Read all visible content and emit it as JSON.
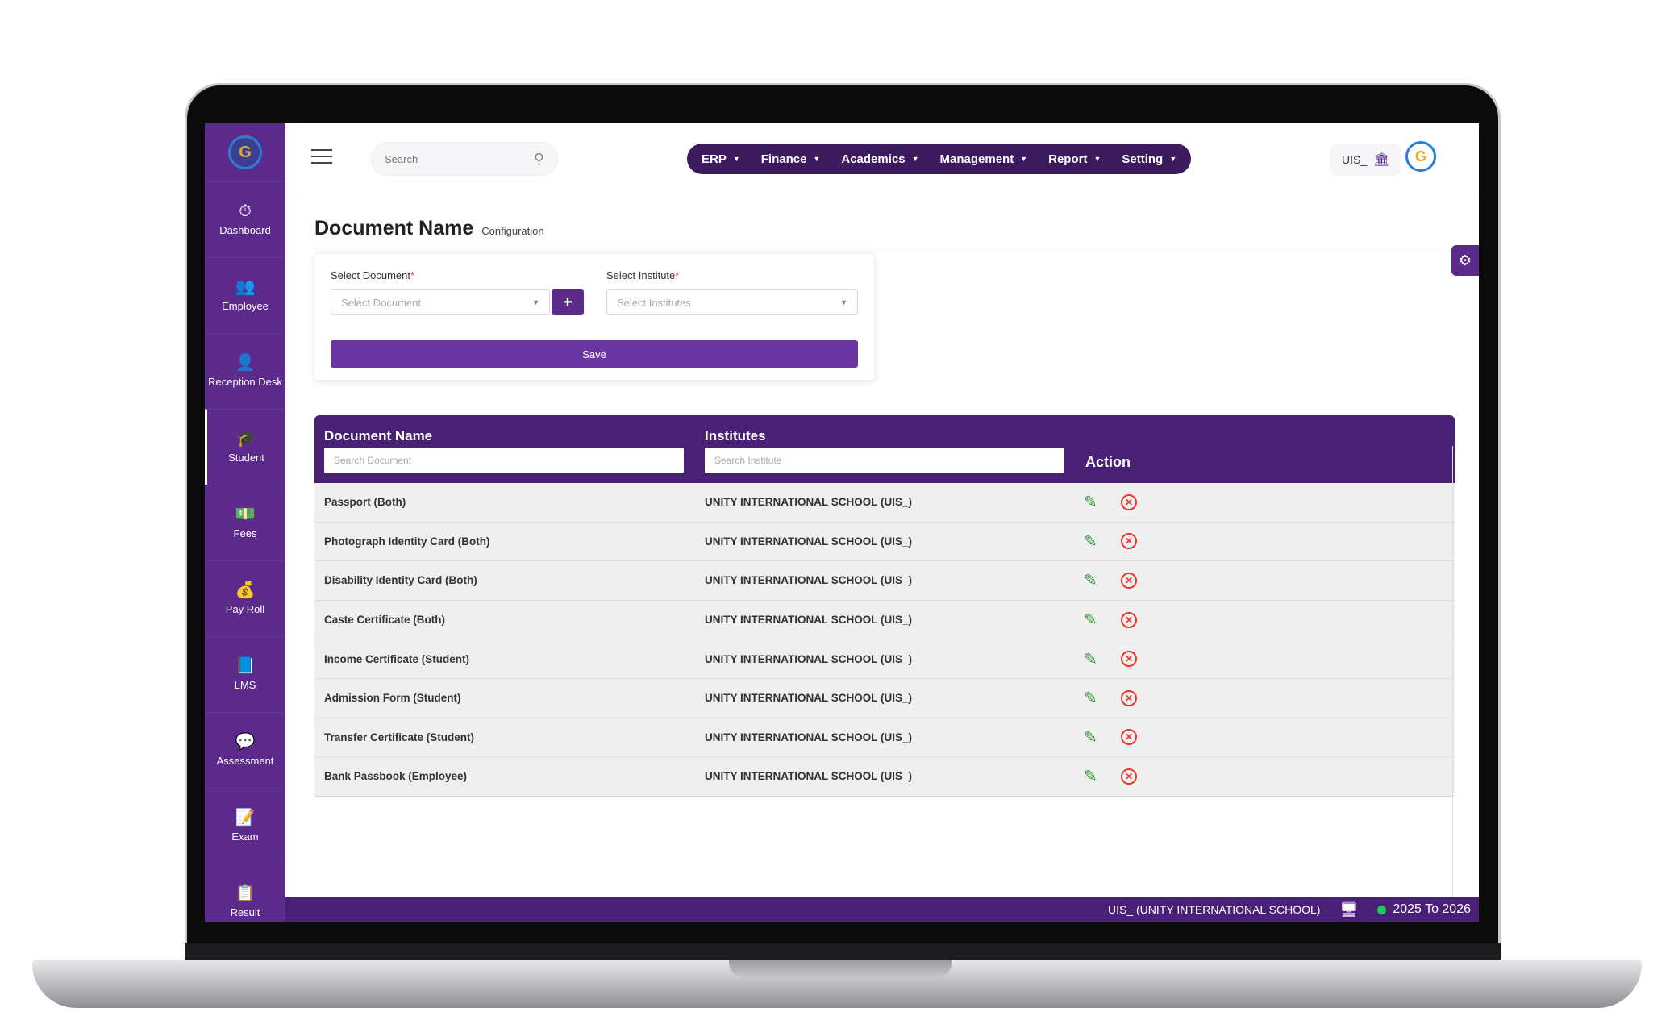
{
  "topbar": {
    "search_placeholder": "Search",
    "menu": [
      {
        "label": "ERP"
      },
      {
        "label": "Finance"
      },
      {
        "label": "Academics"
      },
      {
        "label": "Management"
      },
      {
        "label": "Report"
      },
      {
        "label": "Setting"
      }
    ],
    "institute_code": "UIS_"
  },
  "sidebar": {
    "items": [
      {
        "label": "Dashboard",
        "icon": "dashboard-icon"
      },
      {
        "label": "Employee",
        "icon": "employee-icon"
      },
      {
        "label": "Reception Desk",
        "icon": "reception-icon"
      },
      {
        "label": "Student",
        "icon": "student-icon"
      },
      {
        "label": "Fees",
        "icon": "fees-icon"
      },
      {
        "label": "Pay Roll",
        "icon": "payroll-icon"
      },
      {
        "label": "LMS",
        "icon": "lms-icon"
      },
      {
        "label": "Assessment",
        "icon": "assessment-icon"
      },
      {
        "label": "Exam",
        "icon": "exam-icon"
      },
      {
        "label": "Result",
        "icon": "result-icon"
      }
    ],
    "active": "Student"
  },
  "page": {
    "title": "Document Name",
    "subtitle": "Configuration"
  },
  "form": {
    "document_label": "Select Document",
    "document_placeholder": "Select Document",
    "institute_label": "Select Institute",
    "institute_placeholder": "Select Institutes",
    "required_mark": "*",
    "add_label": "+",
    "save_label": "Save"
  },
  "table": {
    "headers": {
      "document": "Document Name",
      "institutes": "Institutes",
      "action": "Action"
    },
    "search_document_placeholder": "Search  Document",
    "search_institute_placeholder": "Search Institute",
    "rows": [
      {
        "document": "Passport (Both)",
        "institute": "UNITY INTERNATIONAL SCHOOL (UIS_)"
      },
      {
        "document": "Photograph Identity Card (Both)",
        "institute": "UNITY INTERNATIONAL SCHOOL (UIS_)"
      },
      {
        "document": "Disability Identity Card (Both)",
        "institute": "UNITY INTERNATIONAL SCHOOL (UIS_)"
      },
      {
        "document": "Caste Certificate (Both)",
        "institute": "UNITY INTERNATIONAL SCHOOL (UIS_)"
      },
      {
        "document": "Income Certificate (Student)",
        "institute": "UNITY INTERNATIONAL SCHOOL (UIS_)"
      },
      {
        "document": "Admission Form (Student)",
        "institute": "UNITY INTERNATIONAL SCHOOL (UIS_)"
      },
      {
        "document": "Transfer Certificate (Student)",
        "institute": "UNITY INTERNATIONAL SCHOOL (UIS_)"
      },
      {
        "document": "Bank Passbook (Employee)",
        "institute": "UNITY INTERNATIONAL SCHOOL (UIS_)"
      }
    ]
  },
  "statusbar": {
    "institute": "UIS_ (UNITY INTERNATIONAL SCHOOL)",
    "session": "2025 To 2026"
  },
  "colors": {
    "primary": "#5b2a8a",
    "header_dark": "#4a1f76",
    "edit": "#3a9b3a",
    "delete": "#e53935",
    "status_dot": "#22c55e"
  }
}
